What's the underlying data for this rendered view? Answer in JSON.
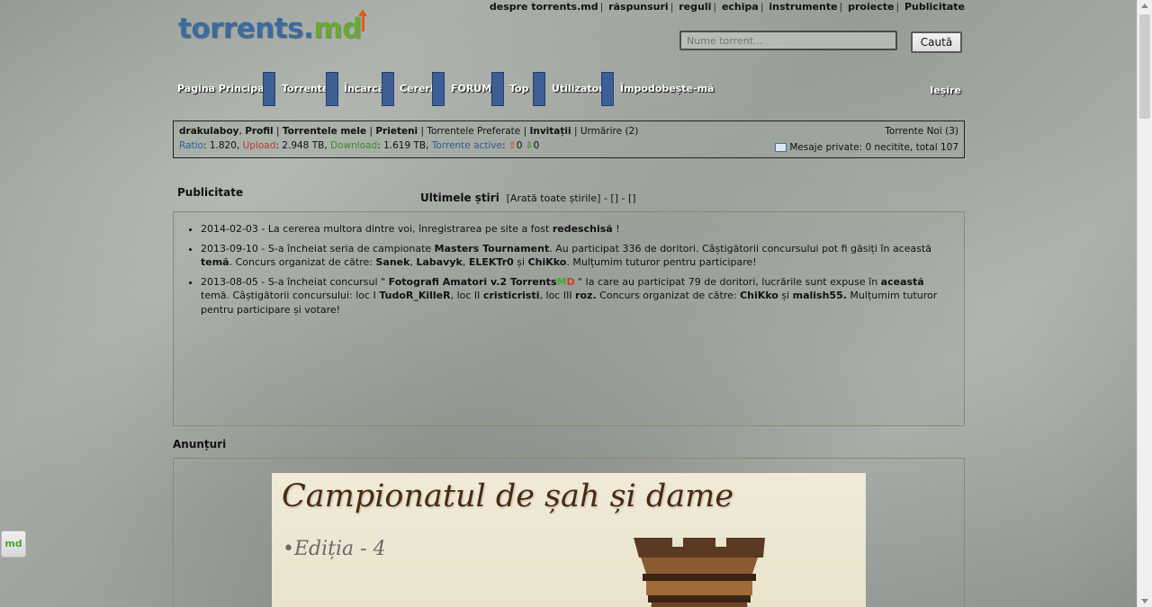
{
  "toplinks": [
    "despre torrents.md",
    "răspunsuri",
    "reguli",
    "echipa",
    "instrumente",
    "proiecte",
    "Publicitate"
  ],
  "logo": {
    "main": "torrents.",
    "md": "md"
  },
  "search": {
    "placeholder": "Nume torrent...",
    "button": "Caută"
  },
  "nav": [
    "Pagina Principală",
    "Torrente",
    "Încarcă",
    "Cereri",
    "FORUM",
    "Top",
    "Utilizatori",
    "Împodobește-mă"
  ],
  "logout": "Ieșire",
  "user": {
    "name": "drakulaboy",
    "links": [
      "Profil",
      "Torrentele mele",
      "Prieteni",
      "Torrentele Preferate",
      "Invitații",
      "Urmărire"
    ],
    "urmarire_count": "(2)",
    "ratio_label": "Ratio",
    "ratio": "1.820",
    "upload_label": "Upload",
    "upload": "2.948 TB",
    "download_label": "Download",
    "download": "1.619 TB",
    "active_label": "Torrente active",
    "active_up": "0",
    "active_down": "0",
    "new_torrents": "Torrente Noi",
    "new_torrents_count": "(3)",
    "messages": "Mesaje private: 0 necitite, total 107"
  },
  "ads_title": "Publicitate",
  "news": {
    "title": "Ultimele știri",
    "show_all": "[Arată toate știrile]",
    "dash1": "-",
    "extra1": "[]",
    "dash2": "-",
    "extra2": "[]",
    "items": [
      {
        "date": "2014-02-03",
        "text": "La cererea multora dintre voi, înregistrarea pe site a fost",
        "bold": "redeschisă",
        "tail": "!"
      },
      {
        "date": "2013-09-10",
        "pre": "S-a încheiat seria de campionate",
        "bold1": "Masters Tournament",
        "mid": ". Au participat 336 de doritori. Câștigătorii concursului pot fi găsiți în această",
        "bold2": "temă",
        "mid2": ". Concurs organizat de către:",
        "n1": "Sanek",
        "n2": "Labavyk",
        "n3": "ELEKTr0",
        "and": "și",
        "n4": "ChiKko",
        "tail": ". Mulțumim tuturor pentru participare!"
      },
      {
        "date": "2013-08-05",
        "pre": "S-a încheiat concursul \"",
        "bold1": "Fotografi Amatori v.2 Torrents",
        "md1": "M",
        "md2": "D",
        "mid": "\" la care au participat 79 de doritori, lucrările sunt expuse în",
        "bold2": "această",
        "mid2": "temă. Câștigătorii concursului: loc I",
        "w1": "TudoR_KilleR",
        "p2": ", loc II",
        "w2": "cristicristi",
        "p3": ", loc III",
        "w3": "roz.",
        "p4": "Concurs organizat de către:",
        "o1": "ChiKko",
        "and": "și",
        "o2": "malish55.",
        "tail": "Mulțumim tuturor pentru participare și votare!"
      }
    ]
  },
  "anunturi_title": "Anunțuri",
  "banner": {
    "title": "Campionatul de șah și dame",
    "subtitle": "•Ediția - 4"
  },
  "side_icon": "md"
}
